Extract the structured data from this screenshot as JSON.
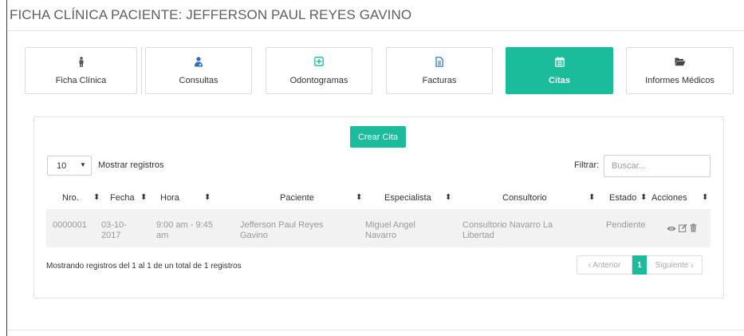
{
  "page": {
    "title": "FICHA CLÍNICA PACIENTE: JEFFERSON PAUL REYES GAVINO"
  },
  "colors": {
    "accent": "#1abc9c",
    "tab_icon_blue": "#2a6ebb",
    "tab_icon_green": "#1abc9c"
  },
  "tabs": [
    {
      "label": "Ficha Clínica",
      "icon": "person-icon",
      "active": false
    },
    {
      "label": "Consultas",
      "icon": "user-md-icon",
      "active": false
    },
    {
      "label": "Odontogramas",
      "icon": "plus-square-icon",
      "active": false
    },
    {
      "label": "Facturas",
      "icon": "file-text-icon",
      "active": false
    },
    {
      "label": "Citas",
      "icon": "calendar-icon",
      "active": true
    },
    {
      "label": "Informes Médicos",
      "icon": "folder-open-icon",
      "active": false
    }
  ],
  "toolbar": {
    "create_label": "Crear Cita"
  },
  "table_controls": {
    "page_length": "10",
    "length_label": "Mostrar registros",
    "filter_label": "Filtrar:",
    "search_placeholder": "Buscar..."
  },
  "table": {
    "columns": [
      "Nro.",
      "Fecha",
      "Hora",
      "Paciente",
      "Especialista",
      "Consultorio",
      "Estado",
      "Acciones"
    ],
    "rows": [
      {
        "nro": "0000001",
        "fecha_1": "03-10-",
        "fecha_2": "2017",
        "hora_1": "9:00 am - 9:45",
        "hora_2": "am",
        "paciente_1": "Jefferson Paul Reyes",
        "paciente_2": "Gavino",
        "especialista_1": "Miguel Angel",
        "especialista_2": "Navarro",
        "consultorio_1": "Consultorio Navarro La",
        "consultorio_2": "Libertad",
        "estado": "Pendiente",
        "actions": [
          "eye-icon",
          "edit-icon",
          "trash-icon"
        ]
      }
    ]
  },
  "footer": {
    "info": "Mostrando registros del 1 al 1 de un total de 1 registros",
    "prev_label": "‹ Anterior",
    "current_page": "1",
    "next_label": "Siguiente ›"
  }
}
